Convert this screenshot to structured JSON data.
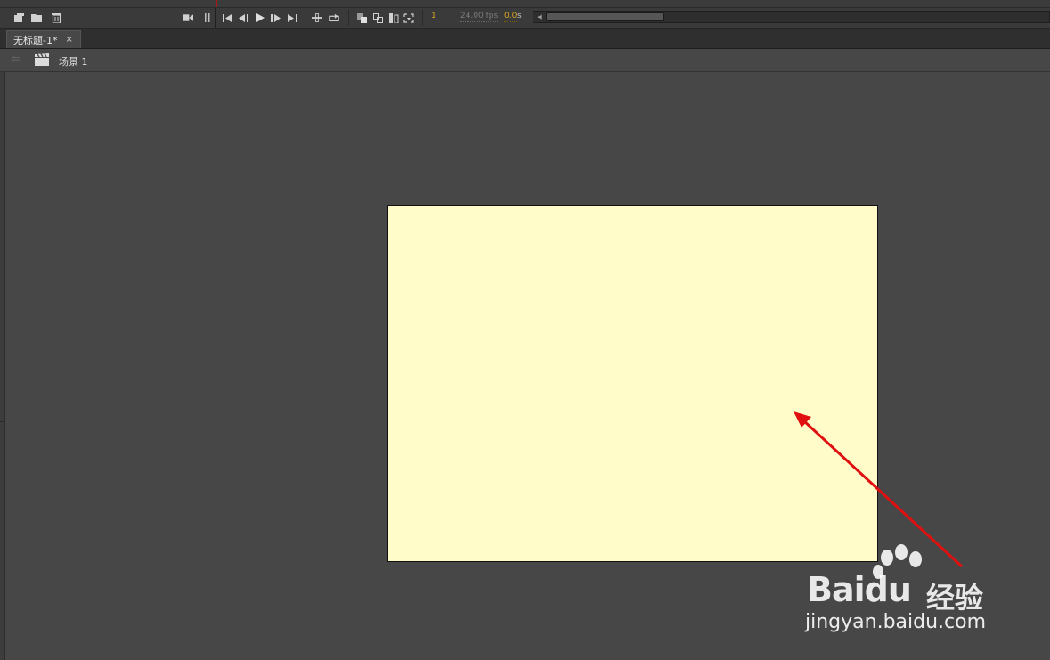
{
  "timeline": {
    "frame_number": "1",
    "fps": "24.00 fps",
    "elapsed": "0.0",
    "elapsed_unit": "s"
  },
  "tabs": [
    {
      "label": "无标题-1*",
      "close": "×"
    }
  ],
  "breadcrumb": {
    "scene_label": "场景 1"
  },
  "stage": {
    "background_color": "#fffcca"
  },
  "annotation": {
    "arrow_color": "#e01010"
  },
  "watermark": {
    "brand": "Baidu",
    "brand_cn": "经验",
    "url": "jingyan.baidu.com"
  },
  "icons": [
    "new-layer-icon",
    "new-folder-icon",
    "delete-icon",
    "camera-icon",
    "pause-icon",
    "go-to-first-icon",
    "step-back-icon",
    "play-icon",
    "step-forward-icon",
    "go-to-last-icon",
    "loop-icon",
    "center-frame-icon",
    "onion-skin-icon",
    "onion-outline-icon",
    "edit-multiple-icon",
    "modify-markers-icon",
    "back-arrow-icon",
    "scene-clapper-icon"
  ]
}
